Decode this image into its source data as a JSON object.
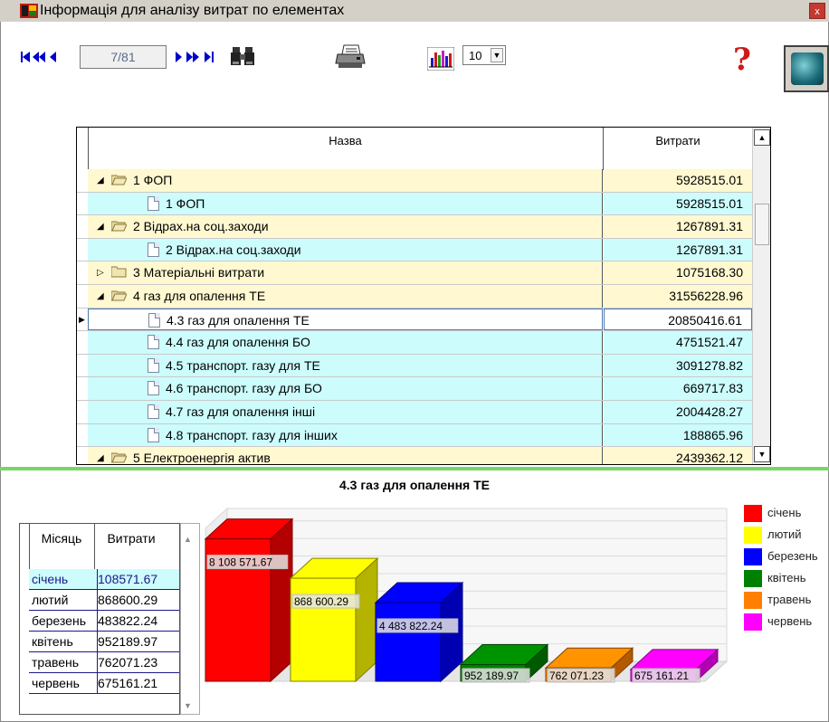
{
  "window": {
    "title": "Інформація для аналізу витрат по елементах",
    "close": "x"
  },
  "toolbar": {
    "page_indicator": "7/81",
    "rows_per_page": "10",
    "help": "?"
  },
  "grid": {
    "columns": [
      "Назва",
      "Витрати"
    ],
    "rows": [
      {
        "kind": "grp",
        "open": true,
        "label": "1 ФОП",
        "value": "5928515.01"
      },
      {
        "kind": "leaf",
        "label": "1 ФОП",
        "value": "5928515.01"
      },
      {
        "kind": "grp",
        "open": true,
        "label": "2 Відрах.на соц.заходи",
        "value": "1267891.31"
      },
      {
        "kind": "leaf",
        "label": "2 Відрах.на соц.заходи",
        "value": "1267891.31"
      },
      {
        "kind": "grp",
        "open": false,
        "label": "3 Матеріальні витрати",
        "value": "1075168.30"
      },
      {
        "kind": "grp",
        "open": true,
        "label": "4 газ для опалення ТЕ",
        "value": "31556228.96"
      },
      {
        "kind": "leaf",
        "selected": true,
        "label": "4.3 газ для опалення ТЕ",
        "value": "20850416.61"
      },
      {
        "kind": "leaf",
        "label": "4.4 газ для опалення БО",
        "value": "4751521.47"
      },
      {
        "kind": "leaf",
        "label": "4.5 транспорт. газу для ТЕ",
        "value": "3091278.82"
      },
      {
        "kind": "leaf",
        "label": "4.6 транспорт. газу для БО",
        "value": "669717.83"
      },
      {
        "kind": "leaf",
        "label": "4.7 газ для опалення інші",
        "value": "2004428.27"
      },
      {
        "kind": "leaf",
        "label": "4.8 транспорт. газу для інших",
        "value": "188865.96"
      },
      {
        "kind": "grp",
        "open": true,
        "label": "5 Електроенергія актив",
        "value": "2439362.12"
      }
    ]
  },
  "chart_title": "4.3 газ для опалення ТЕ",
  "month_table": {
    "columns": [
      "Місяць",
      "Витрати"
    ],
    "rows": [
      [
        "січень",
        "108571.67"
      ],
      [
        "лютий",
        "868600.29"
      ],
      [
        "березень",
        "483822.24"
      ],
      [
        "квітень",
        "952189.97"
      ],
      [
        "травень",
        "762071.23"
      ],
      [
        "червень",
        "675161.21"
      ]
    ]
  },
  "chart_data": {
    "type": "bar",
    "title": "4.3 газ для опалення ТЕ",
    "categories": [
      "січень",
      "лютий",
      "березень",
      "квітень",
      "травень",
      "червень"
    ],
    "values": [
      108571.67,
      868600.29,
      483822.24,
      952189.97,
      762071.23,
      675161.21
    ],
    "bar_labels": [
      "8 108 571.67",
      "868 600.29",
      "4 483 822.24",
      "952 189.97",
      "762 071.23",
      "675 161.21"
    ],
    "bar_levels": [
      8108571.67,
      5868600.29,
      4483822.24,
      952189.97,
      762071.23,
      675161.21
    ],
    "colors": [
      "#ff0000",
      "#ffff00",
      "#0000ff",
      "#008000",
      "#ff8000",
      "#ff00ff"
    ],
    "legend": [
      "січень",
      "лютий",
      "березень",
      "квітень",
      "травень",
      "червень"
    ],
    "legend_position": "right",
    "style": "3d",
    "grid": true
  }
}
